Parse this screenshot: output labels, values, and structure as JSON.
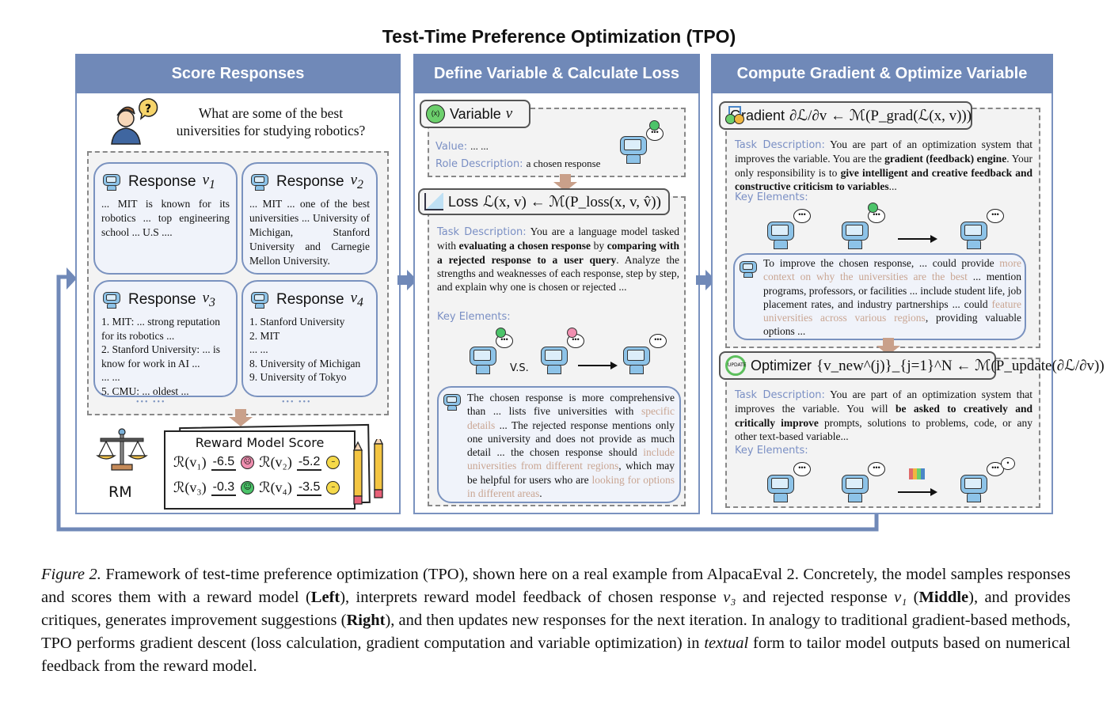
{
  "figure_title": "Test-Time Preference Optimization (TPO)",
  "panels": {
    "left": {
      "header": "Score Responses",
      "query": [
        "What are some of the best",
        "universities for studying robotics?"
      ],
      "user_icon": "user-question-icon",
      "responses": [
        {
          "label": "Response",
          "var": "v",
          "sub": "1",
          "lines": [
            "... MIT is known for its robotics ... top engineering school ... U.S ...."
          ]
        },
        {
          "label": "Response",
          "var": "v",
          "sub": "2",
          "lines": [
            "... MIT ... one of the best universities ... University of Michigan, Stanford University and Carnegie Mellon University."
          ]
        },
        {
          "label": "Response",
          "var": "v",
          "sub": "3",
          "lines": [
            "1. MIT: ... strong reputation for its robotics ...",
            "2. Stanford University: ... is know for work in AI ...",
            "... ...",
            "5. CMU: ... oldest ..."
          ]
        },
        {
          "label": "Response",
          "var": "v",
          "sub": "4",
          "lines": [
            "1. Stanford University",
            "2. MIT",
            "... ...",
            "8. University of Michigan",
            "9. University of Tokyo"
          ]
        }
      ],
      "ellipsis": "•••  •••",
      "rm_label": "RM",
      "score_title": "Reward Model Score",
      "scores": [
        {
          "label": "ℛ(v₁)",
          "value": "-6.5",
          "mood": "sad",
          "color": "#f08fb0"
        },
        {
          "label": "ℛ(v₂)",
          "value": "-5.2",
          "mood": "neutral",
          "color": "#f5d94a"
        },
        {
          "label": "ℛ(v₃)",
          "value": "-0.3",
          "mood": "happy",
          "color": "#4cc46a"
        },
        {
          "label": "ℛ(v₄)",
          "value": "-3.5",
          "mood": "neutral",
          "color": "#f5d94a"
        }
      ]
    },
    "middle": {
      "header": "Define Variable & Calculate Loss",
      "variable": {
        "title": "Variable",
        "math": "v",
        "value_label": "Value:",
        "value": "... ...",
        "role_label": "Role Description:",
        "role": "a chosen response"
      },
      "loss": {
        "title": "Loss",
        "math": "ℒ(x, v) ← ℳ(P_loss(x, v, v̂))"
      },
      "task_label": "Task Description:",
      "task_segments": [
        {
          "t": "You are a language model tasked with ",
          "b": false
        },
        {
          "t": "evaluating a chosen response",
          "b": true
        },
        {
          "t": " by ",
          "b": false
        },
        {
          "t": "comparing with a rejected response to a user query",
          "b": true
        },
        {
          "t": ". Analyze the strengths and weaknesses of each response, step by step, and explain why one is chosen or rejected ...",
          "b": false
        }
      ],
      "key_label": "Key Elements:",
      "vs_label": "V.S.",
      "feedback_segments": [
        {
          "t": "The chosen response is more comprehensive than ... lists five universities with ",
          "h": false
        },
        {
          "t": "specific details",
          "h": true
        },
        {
          "t": " ... The rejected response mentions only one university and does not provide as much detail ... the chosen response should ",
          "h": false
        },
        {
          "t": "include universities from different regions",
          "h": true
        },
        {
          "t": ", which may be helpful for users who are ",
          "h": false
        },
        {
          "t": "looking for options in different areas",
          "h": true
        },
        {
          "t": ".",
          "h": false
        }
      ]
    },
    "right": {
      "header": "Compute Gradient & Optimize Variable",
      "gradient": {
        "title": "Gradient",
        "math": "∂ℒ/∂v ← ℳ(P_grad(ℒ(x, v)))"
      },
      "gradient_task_label": "Task Description:",
      "gradient_task_segments": [
        {
          "t": "You are part of an optimization system that improves the variable.  You are the ",
          "b": false
        },
        {
          "t": "gradient (feedback) engine",
          "b": true
        },
        {
          "t": ".  Your only responsibility is to ",
          "b": false
        },
        {
          "t": "give intelligent and creative feedback and constructive criticism to variables",
          "b": true
        },
        {
          "t": "...",
          "b": false
        }
      ],
      "key_label": "Key Elements:",
      "suggestion_segments": [
        {
          "t": "To improve the chosen response, ... could provide ",
          "h": false
        },
        {
          "t": "more context on why the universities are the best",
          "h": true
        },
        {
          "t": " ... mention programs, professors, or facilities ... include student life, job placement rates, and industry partnerships ... could ",
          "h": false
        },
        {
          "t": "feature universities across various regions",
          "h": true
        },
        {
          "t": ", providing valuable options ...",
          "h": false
        }
      ],
      "optimizer": {
        "title": "Optimizer",
        "math": "{v_new^(j)}_{j=1}^N ← ℳ(P_update(∂ℒ/∂v))"
      },
      "optimizer_task_label": "Task Description:",
      "optimizer_task_segments": [
        {
          "t": "You are part of an optimization system that improves the variable. You will ",
          "b": false
        },
        {
          "t": "be asked to creatively and critically improve",
          "b": true
        },
        {
          "t": " prompts, solutions to problems, code, or any other text-based variable...",
          "b": false
        }
      ],
      "key_label2": "Key Elements:"
    }
  },
  "colors": {
    "panel_header": "#7089b8",
    "panel_border": "#7a92bf",
    "highlight": "#c9a592",
    "label_blue": "#7a8fc4",
    "down_arrow": "#c9a08a"
  },
  "caption_segments": [
    {
      "t": "Figure 2.",
      "s": "i"
    },
    {
      "t": " Framework of test-time preference optimization (TPO), shown here on a real example from AlpacaEval 2. Concretely, the model samples responses and scores them with a reward model (",
      "s": ""
    },
    {
      "t": "Left",
      "s": "b"
    },
    {
      "t": "), interprets reward model feedback of chosen response ",
      "s": ""
    },
    {
      "t": "v₃",
      "s": "i"
    },
    {
      "t": " and rejected response ",
      "s": ""
    },
    {
      "t": "v₁",
      "s": "i"
    },
    {
      "t": " (",
      "s": ""
    },
    {
      "t": "Middle",
      "s": "b"
    },
    {
      "t": "), and provides critiques, generates improvement suggestions (",
      "s": ""
    },
    {
      "t": "Right",
      "s": "b"
    },
    {
      "t": "), and then updates new responses for the next iteration. In analogy to traditional gradient-based methods, TPO performs gradient descent (loss calculation, gradient computation and variable optimization) in ",
      "s": ""
    },
    {
      "t": "textual",
      "s": "i"
    },
    {
      "t": " form to tailor model outputs based on numerical feedback from the reward model.",
      "s": ""
    }
  ]
}
